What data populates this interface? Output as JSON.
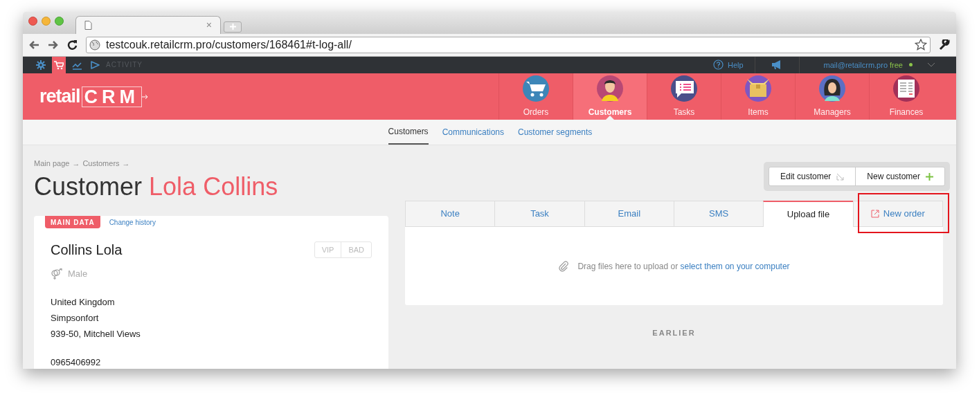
{
  "browser": {
    "tab_close": "×",
    "url": "testcouk.retailcrm.pro/customers/168461#t-log-all/"
  },
  "topbar": {
    "icons": [
      {
        "kind": "settings",
        "selected": false
      },
      {
        "kind": "cart",
        "selected": true
      },
      {
        "kind": "chart",
        "selected": false
      },
      {
        "kind": "play",
        "selected": false
      }
    ],
    "label": "ACTIVITY",
    "help": "Help",
    "email": "mail@retailcrm.pro",
    "plan": "free"
  },
  "header": {
    "logo": [
      "retail",
      "CRM"
    ],
    "nav": [
      {
        "label": "Orders",
        "kind": "cart",
        "selected": false
      },
      {
        "label": "Customers",
        "kind": "person",
        "selected": true
      },
      {
        "label": "Tasks",
        "kind": "chat",
        "selected": false
      },
      {
        "label": "Items",
        "kind": "box",
        "selected": false
      },
      {
        "label": "Managers",
        "kind": "woman",
        "selected": false
      },
      {
        "label": "Finances",
        "kind": "sheet",
        "selected": false
      }
    ]
  },
  "subnav": [
    {
      "label": "Customers",
      "selected": true
    },
    {
      "label": "Communications",
      "selected": false
    },
    {
      "label": "Customer segments",
      "selected": false
    }
  ],
  "breadcrumb": [
    {
      "label": "Main page",
      "sep": "→"
    },
    {
      "label": "Customers",
      "sep": "→"
    }
  ],
  "title": {
    "prefix": "Customer",
    "name": "Lola Collins"
  },
  "actions": [
    {
      "label": "Edit customer",
      "kind": "edit"
    },
    {
      "label": "New customer",
      "kind": "plus"
    }
  ],
  "card": {
    "tabs": [
      {
        "label": "MAIN DATA",
        "selected": true
      },
      {
        "label": "Change history",
        "selected": false
      }
    ],
    "name": "Collins Lola",
    "tags": [
      {
        "label": "VIP",
        "on": false
      },
      {
        "label": "BAD",
        "on": false
      }
    ],
    "gender": "Male",
    "address": [
      "United Kingdom",
      "Simpsonfort",
      "939-50, Mitchell Views"
    ],
    "phone": "0965406992"
  },
  "panel": {
    "tabs": [
      {
        "label": "Note",
        "kind": "plain",
        "selected": false,
        "highlighted": false
      },
      {
        "label": "Task",
        "kind": "plain",
        "selected": false,
        "highlighted": false
      },
      {
        "label": "Email",
        "kind": "plain",
        "selected": false,
        "highlighted": false
      },
      {
        "label": "SMS",
        "kind": "plain",
        "selected": false,
        "highlighted": false
      },
      {
        "label": "Upload file",
        "kind": "plain",
        "selected": true,
        "highlighted": false
      },
      {
        "label": "New order",
        "kind": "external",
        "selected": false,
        "highlighted": true
      }
    ],
    "upload_text": "Drag files here to upload or",
    "upload_link": "select them on your computer",
    "earlier": "EARLIER"
  }
}
